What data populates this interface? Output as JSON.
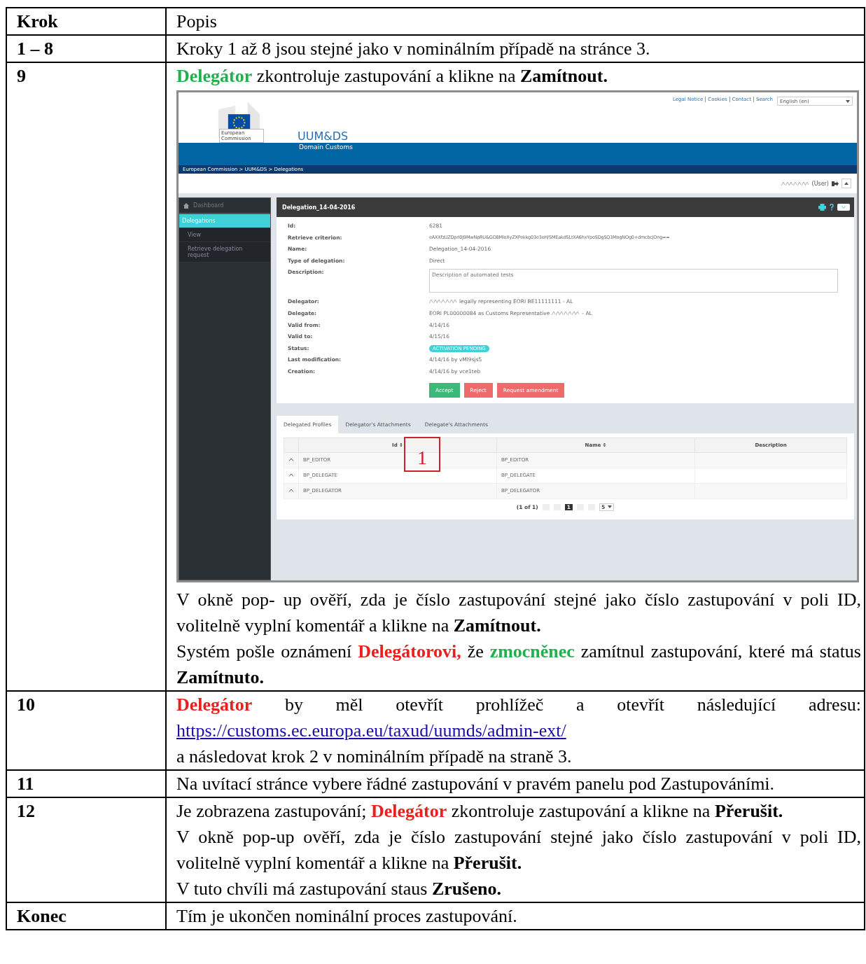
{
  "table": {
    "columns": [
      "Krok",
      "Popis"
    ],
    "rows": [
      {
        "step": "1 – 8",
        "blocks": [
          {
            "kind": "text",
            "runs": [
              {
                "text": "Kroky 1 až 8 jsou stejné jako v nominálním případě na stránce 3."
              }
            ]
          }
        ]
      },
      {
        "step": "9",
        "blocks": [
          {
            "kind": "text",
            "runs": [
              {
                "text": "Delegátor",
                "bold": true,
                "color": "#21b04b"
              },
              {
                "text": " zkontroluje zastupování a klikne na "
              },
              {
                "text": "Zamítnout.",
                "bold": true
              }
            ]
          },
          {
            "kind": "screenshot"
          },
          {
            "kind": "text",
            "runs": [
              {
                "text": "V okně pop- up ověří, zda je číslo zastupování stejné jako číslo zastupování v poli ID, volitelně vyplní komentář a klikne na "
              },
              {
                "text": "Zamítnout.",
                "bold": true
              }
            ]
          },
          {
            "kind": "text",
            "runs": [
              {
                "text": "Systém pošle oznámení "
              },
              {
                "text": "Delegátorovi,",
                "bold": true,
                "color": "#e8201e"
              },
              {
                "text": " že "
              },
              {
                "text": "zmocněnec",
                "bold": true,
                "color": "#21b04b"
              },
              {
                "text": " zamítnul zastupování, které má status "
              },
              {
                "text": "Zamítnuto.",
                "bold": true
              }
            ]
          }
        ]
      },
      {
        "step": "10",
        "blocks": [
          {
            "kind": "text",
            "runs": [
              {
                "text": "Delegátor",
                "bold": true,
                "color": "#e8201e"
              },
              {
                "text": " by měl otevřít prohlížeč a otevřít následující adresu: "
              },
              {
                "text": "https://customs.ec.europa.eu/taxud/uumds/admin-ext/",
                "link": true
              }
            ]
          },
          {
            "kind": "text",
            "runs": [
              {
                "text": " a následovat krok 2 v nominálním případě na straně 3."
              }
            ]
          }
        ]
      },
      {
        "step": "11",
        "blocks": [
          {
            "kind": "text",
            "runs": [
              {
                "text": "Na uvítací stránce vybere řádné zastupování v pravém panelu pod Zastupováními."
              }
            ]
          }
        ]
      },
      {
        "step": "12",
        "blocks": [
          {
            "kind": "text",
            "runs": [
              {
                "text": "Je zobrazena zastupování; "
              },
              {
                "text": "Delegátor",
                "bold": true,
                "color": "#e8201e"
              },
              {
                "text": " zkontroluje zastupování a klikne na "
              },
              {
                "text": "Přerušit.",
                "bold": true
              }
            ]
          },
          {
            "kind": "text",
            "runs": [
              {
                "text": "V okně pop-up ověří, zda je číslo zastupování stejné jako číslo zastupování v poli ID, volitelně vyplní komentář a klikne na "
              },
              {
                "text": "Přerušit.",
                "bold": true
              }
            ]
          },
          {
            "kind": "text",
            "runs": [
              {
                "text": "V tuto chvíli má zastupování staus "
              },
              {
                "text": "Zrušeno.",
                "bold": true
              }
            ]
          }
        ]
      },
      {
        "step": "Konec",
        "blocks": [
          {
            "kind": "text",
            "runs": [
              {
                "text": "Tím je ukončen nominální proces zastupování."
              }
            ]
          }
        ]
      }
    ]
  },
  "screenshot": {
    "top_links": [
      "Legal Notice",
      "Cookies",
      "Contact",
      "Search"
    ],
    "language": "English (en)",
    "logo_caption": "European Commission",
    "app_title": "UUM&DS",
    "app_subtitle": "Domain Customs",
    "breadcrumb": "European Commission > UUM&DS > Delegations",
    "user": "(User)",
    "sidebar": {
      "header": "Dashboard",
      "items": [
        {
          "label": "Delegations",
          "selected": true
        },
        {
          "label": "View",
          "selected": false
        },
        {
          "label": "Retrieve delegation request",
          "selected": false
        }
      ]
    },
    "panel_title": "Delegation_14-04-2016",
    "fields": [
      {
        "label": "Id:",
        "kind": "text",
        "value": [
          {
            "kind": "text",
            "text": "6281"
          }
        ]
      },
      {
        "label": "Retrieve criterion:",
        "kind": "text",
        "value": [
          {
            "kind": "text",
            "text": "eAXXfzUZDpri0J9MwNpRU&GO8MloXyZXPekkg03e3oH/SMEakdSLtXA6hxYpoSDgSQ3MogNOg0+dmcbcjOng=="
          }
        ]
      },
      {
        "label": "Name:",
        "kind": "text",
        "value": [
          {
            "kind": "text",
            "text": "Delegation_14-04-2016"
          }
        ]
      },
      {
        "label": "Type of delegation:",
        "kind": "text",
        "value": [
          {
            "kind": "text",
            "text": "Direct"
          }
        ]
      },
      {
        "label": "Description:",
        "kind": "textarea",
        "value": [
          {
            "kind": "text",
            "text": "Description of automated tests"
          }
        ]
      },
      {
        "label": "Delegator:",
        "kind": "text",
        "value": [
          {
            "kind": "redacted"
          },
          {
            "kind": "text",
            "text": "legally representing EORI BE11111111 - AL"
          }
        ]
      },
      {
        "label": "Delegate:",
        "kind": "text",
        "value": [
          {
            "kind": "text",
            "text": "EORI PL00000084 as Customs Representative"
          },
          {
            "kind": "redacted"
          },
          {
            "kind": "text",
            "text": "- AL"
          }
        ]
      },
      {
        "label": "Valid from:",
        "kind": "text",
        "value": [
          {
            "kind": "text",
            "text": "4/14/16"
          }
        ]
      },
      {
        "label": "Valid to:",
        "kind": "text",
        "value": [
          {
            "kind": "text",
            "text": "4/15/16"
          }
        ]
      },
      {
        "label": "Status:",
        "kind": "badge",
        "value": [
          {
            "kind": "text",
            "text": "ACTIVATION PENDING"
          }
        ]
      },
      {
        "label": "Last modification:",
        "kind": "text",
        "value": [
          {
            "kind": "text",
            "text": "4/14/16 by vMl9sjs5"
          }
        ]
      },
      {
        "label": "Creation:",
        "kind": "text",
        "value": [
          {
            "kind": "text",
            "text": "4/14/16 by vce1teb"
          }
        ]
      }
    ],
    "buttons": [
      {
        "label": "Accept",
        "color": "#3cb878"
      },
      {
        "label": "Reject",
        "color": "#ef6a6a"
      },
      {
        "label": "Request amendment",
        "color": "#ef6a6a"
      }
    ],
    "callout": "1",
    "tabs": [
      {
        "label": "Delegated Profiles",
        "selected": true
      },
      {
        "label": "Delegator's Attachments",
        "selected": false
      },
      {
        "label": "Delegate's Attachments",
        "selected": false
      }
    ],
    "grid": {
      "columns": [
        "Id ⇕",
        "Name ⇕",
        "Description"
      ],
      "rows": [
        [
          "BP_EDITOR",
          "BP_EDITOR",
          ""
        ],
        [
          "BP_DELEGATE",
          "BP_DELEGATE",
          ""
        ],
        [
          "BP_DELEGATOR",
          "BP_DELEGATOR",
          ""
        ]
      ]
    },
    "pagination": {
      "summary": "(1 of 1)",
      "page": "1",
      "per_page": "5"
    }
  }
}
